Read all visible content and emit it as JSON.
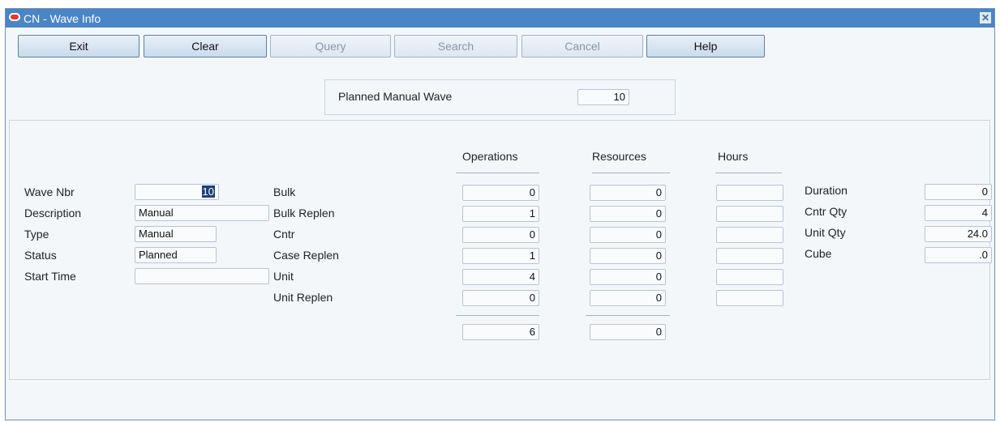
{
  "window": {
    "title": "CN - Wave Info"
  },
  "toolbar": {
    "exit": "Exit",
    "clear": "Clear",
    "query": "Query",
    "search": "Search",
    "cancel": "Cancel",
    "help": "Help"
  },
  "planned": {
    "label": "Planned Manual Wave",
    "value": "10"
  },
  "wave": {
    "nbr_label": "Wave Nbr",
    "nbr_value": "10",
    "desc_label": "Description",
    "desc_value": "Manual",
    "type_label": "Type",
    "type_value": "Manual",
    "status_label": "Status",
    "status_value": "Planned",
    "start_label": "Start Time",
    "start_value": ""
  },
  "headers": {
    "operations": "Operations",
    "resources": "Resources",
    "hours": "Hours"
  },
  "rows": [
    {
      "label": "Bulk",
      "ops": "0",
      "res": "0",
      "hrs": ""
    },
    {
      "label": "Bulk Replen",
      "ops": "1",
      "res": "0",
      "hrs": ""
    },
    {
      "label": "Cntr",
      "ops": "0",
      "res": "0",
      "hrs": ""
    },
    {
      "label": "Case Replen",
      "ops": "1",
      "res": "0",
      "hrs": ""
    },
    {
      "label": "Unit",
      "ops": "4",
      "res": "0",
      "hrs": ""
    },
    {
      "label": "Unit Replen",
      "ops": "0",
      "res": "0",
      "hrs": ""
    }
  ],
  "totals": {
    "ops": "6",
    "res": "0"
  },
  "summary": {
    "duration_label": "Duration",
    "duration_value": "0",
    "cntr_label": "Cntr Qty",
    "cntr_value": "4",
    "unit_label": "Unit Qty",
    "unit_value": "24.0",
    "cube_label": "Cube",
    "cube_value": ".0"
  }
}
